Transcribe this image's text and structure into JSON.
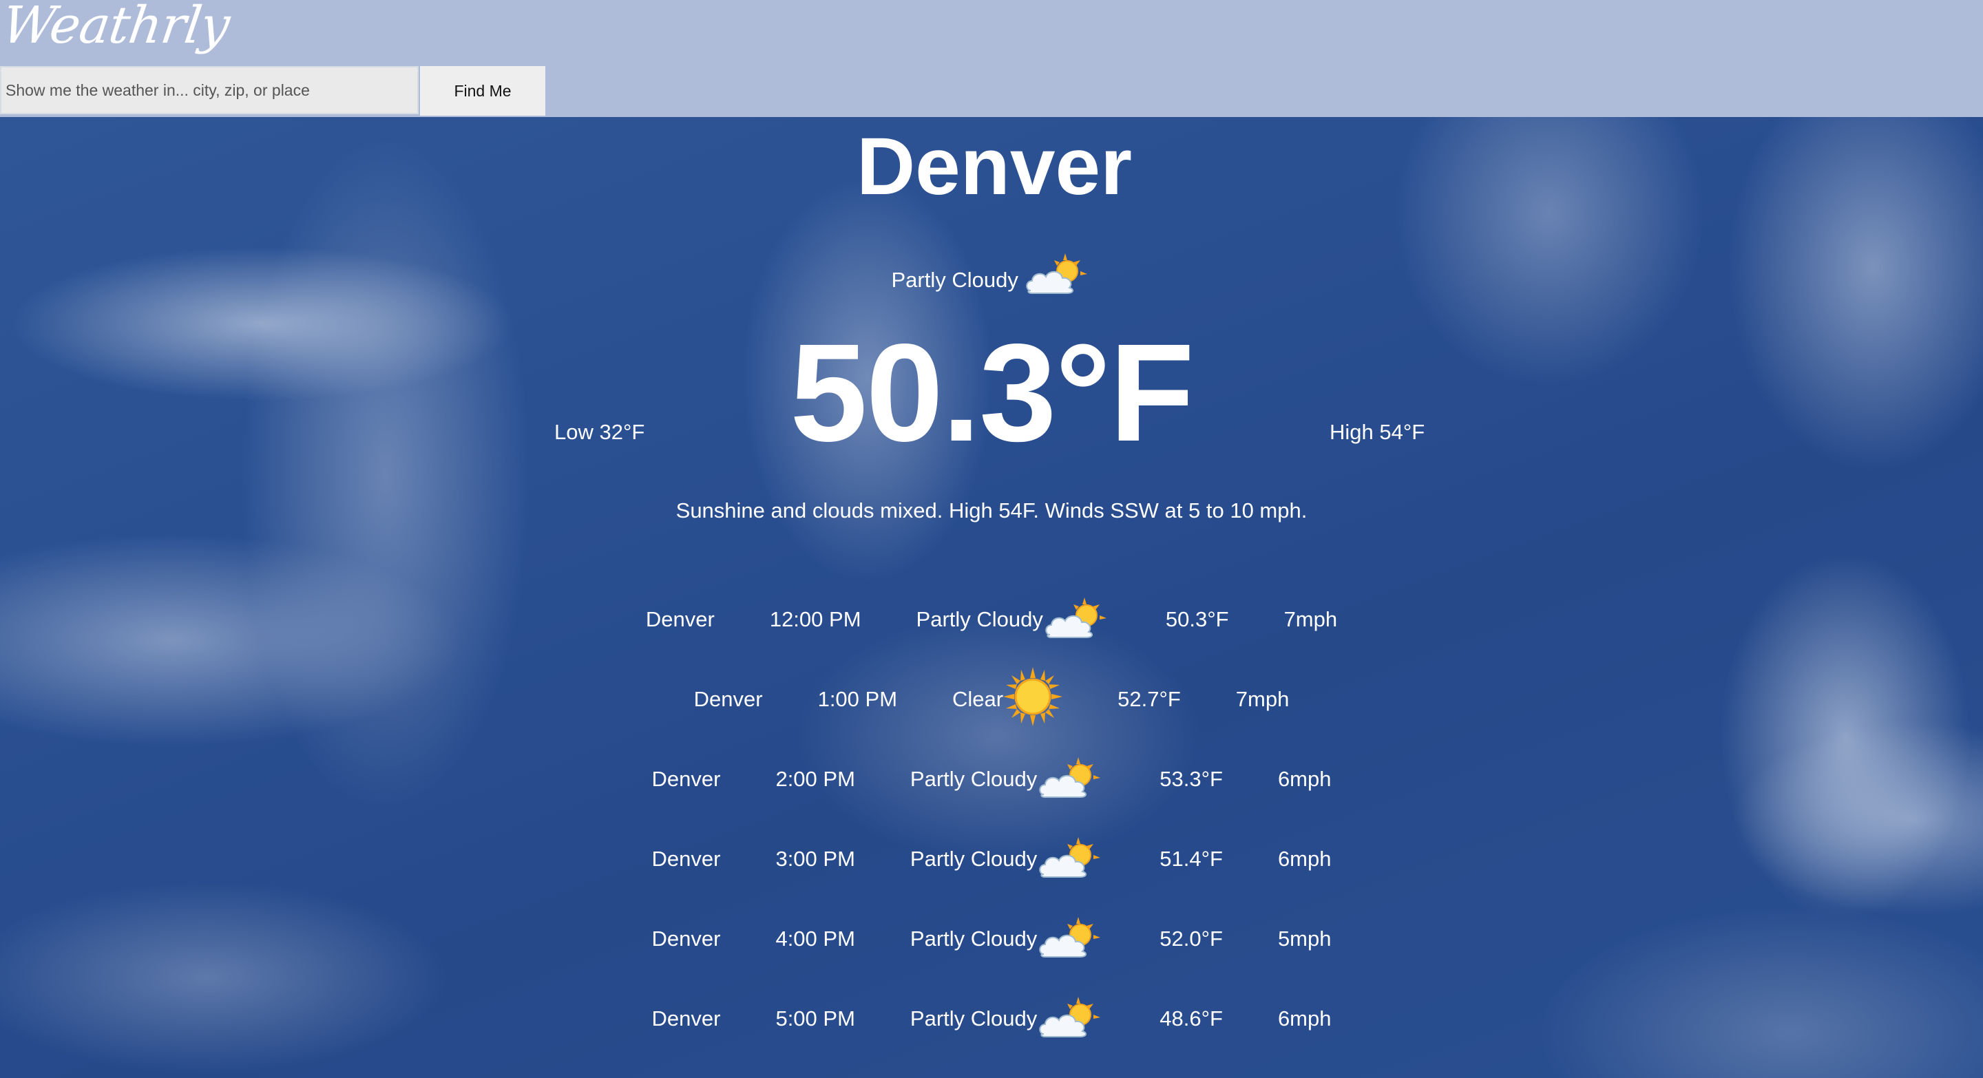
{
  "app": {
    "logo": "Weathrly"
  },
  "search": {
    "placeholder": "Show me the weather in... city, zip, or place",
    "button_label": "Find Me"
  },
  "current": {
    "city": "Denver",
    "condition": "Partly Cloudy",
    "condition_icon": "partly-cloudy-icon",
    "temperature": "50.3°F",
    "low": "Low 32°F",
    "high": "High 54°F",
    "summary": "Sunshine and clouds mixed. High 54F. Winds SSW at 5 to 10 mph."
  },
  "hourly": [
    {
      "city": "Denver",
      "time": "12:00 PM",
      "condition": "Partly Cloudy",
      "icon": "partly-cloudy-icon",
      "temp": "50.3°F",
      "wind": "7mph"
    },
    {
      "city": "Denver",
      "time": "1:00 PM",
      "condition": "Clear",
      "icon": "sun-icon",
      "temp": "52.7°F",
      "wind": "7mph"
    },
    {
      "city": "Denver",
      "time": "2:00 PM",
      "condition": "Partly Cloudy",
      "icon": "partly-cloudy-icon",
      "temp": "53.3°F",
      "wind": "6mph"
    },
    {
      "city": "Denver",
      "time": "3:00 PM",
      "condition": "Partly Cloudy",
      "icon": "partly-cloudy-icon",
      "temp": "51.4°F",
      "wind": "6mph"
    },
    {
      "city": "Denver",
      "time": "4:00 PM",
      "condition": "Partly Cloudy",
      "icon": "partly-cloudy-icon",
      "temp": "52.0°F",
      "wind": "5mph"
    },
    {
      "city": "Denver",
      "time": "5:00 PM",
      "condition": "Partly Cloudy",
      "icon": "partly-cloudy-icon",
      "temp": "48.6°F",
      "wind": "6mph"
    }
  ],
  "colors": {
    "header_bg": "#aebcda",
    "sky": "#2a4f91",
    "text": "#ffffff"
  }
}
